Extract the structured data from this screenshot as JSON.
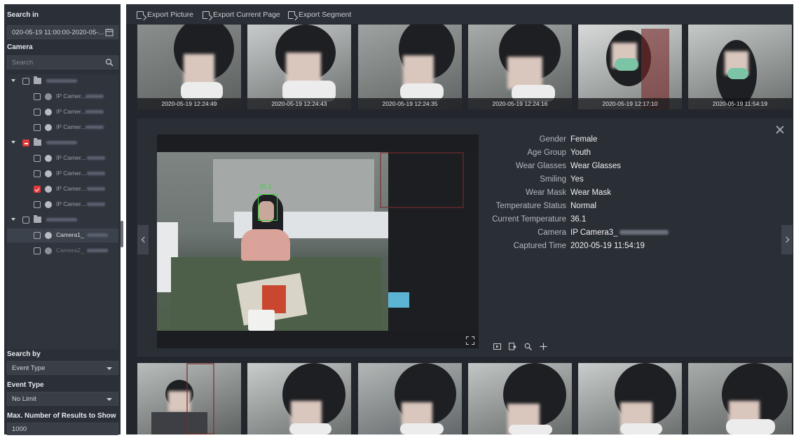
{
  "left": {
    "search_in_label": "Search in",
    "date_range": "020-05-19 11:00:00-2020-05-...",
    "camera_label": "Camera",
    "search_placeholder": "Search",
    "tree": {
      "camera_items": [
        "IP Camer...",
        "IP Camer...",
        "IP Camer...",
        "IP Camer...",
        "IP Camer...",
        "IP Camer...",
        "IP Camer...",
        "Camera1_",
        "Camera2_"
      ]
    },
    "search_by_label": "Search by",
    "search_by_value": "Event Type",
    "event_type_label": "Event Type",
    "event_type_value": "No Limit",
    "max_results_label": "Max. Number of Results to Show",
    "max_results_value": "1000"
  },
  "toolbar": {
    "export_picture": "Export Picture",
    "export_current_page": "Export Current Page",
    "export_segment": "Export Segment"
  },
  "top_thumbnails": [
    {
      "time": "2020-05-19 12:24:49"
    },
    {
      "time": "2020-05-19 12:24:43"
    },
    {
      "time": "2020-05-19 12:24:35"
    },
    {
      "time": "2020-05-19 12:24:16"
    },
    {
      "time": "2020-05-19 12:17:10"
    },
    {
      "time": "2020-05-19 11:54:19",
      "selected": true
    }
  ],
  "detail": {
    "attributes": [
      {
        "key": "Gender",
        "value": "Female"
      },
      {
        "key": "Age Group",
        "value": "Youth"
      },
      {
        "key": "Wear Glasses",
        "value": "Wear Glasses"
      },
      {
        "key": "Smiling",
        "value": "Yes"
      },
      {
        "key": "Wear Mask",
        "value": "Wear Mask"
      },
      {
        "key": "Temperature Status",
        "value": "Normal"
      },
      {
        "key": "Current Temperature",
        "value": "36.1"
      },
      {
        "key": "Camera",
        "value": "IP Camera3_"
      },
      {
        "key": "Captured Time",
        "value": "2020-05-19 11:54:19"
      }
    ],
    "overlay_temp": "36.1",
    "tool_icons": [
      "play-icon",
      "export-icon",
      "search-icon",
      "plus-icon"
    ]
  },
  "colors": {
    "panel_bg": "#2b3038",
    "main_bg": "#23272d",
    "detail_bg": "#2a2e35",
    "accent_red": "#e03a3a",
    "detection_green": "#37d43a"
  }
}
